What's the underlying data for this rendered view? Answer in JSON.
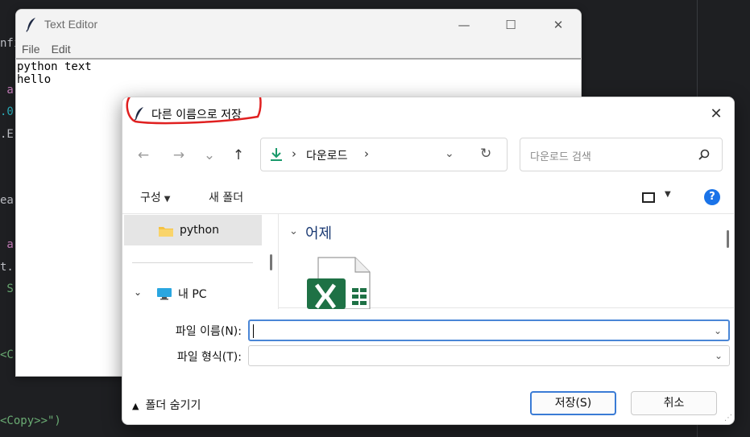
{
  "background_code": {
    "lines": [
      {
        "text": "nfi",
        "color": "#bcbec4"
      },
      {
        "text": " a",
        "color": "#c77dbb"
      },
      {
        "text": ".0",
        "color": "#2aacb8"
      },
      {
        "text": ".E",
        "color": "#bcbec4"
      },
      {
        "text": "ea",
        "color": "#bcbec4"
      },
      {
        "text": " a",
        "color": "#c77dbb"
      },
      {
        "text": "t.",
        "color": "#bcbec4"
      },
      {
        "text": " S",
        "color": "#6aab73"
      },
      {
        "text": "<C",
        "color": "#6aab73"
      },
      {
        "text": "<Copy>>\")",
        "color": "#6aab73"
      }
    ]
  },
  "text_editor": {
    "title": "Text Editor",
    "menu": [
      "File",
      "Edit"
    ],
    "content_lines": [
      "python text",
      "hello"
    ],
    "controls": {
      "minimize": "—",
      "maximize": "☐",
      "close": "✕"
    }
  },
  "save_dialog": {
    "title": "다른 이름으로 저장",
    "close": "✕",
    "annotation_color": "#e02020",
    "nav": {
      "back": "←",
      "forward": "→",
      "recent": "⌄",
      "up": "↑"
    },
    "address": {
      "location": "다운로드",
      "sep": "›"
    },
    "search_placeholder": "다운로드 검색",
    "toolbar": {
      "organize": "구성",
      "new_folder": "새 폴더",
      "help": "?"
    },
    "nav_pane": {
      "selected": "python",
      "this_pc": "내 PC"
    },
    "content": {
      "group": "어제"
    },
    "filename_label": "파일 이름(N):",
    "filename_value": "",
    "filetype_label": "파일 형식(T):",
    "filetype_value": "",
    "hide_folders": "폴더 숨기기",
    "save_button": "저장(S)",
    "cancel_button": "취소",
    "accent": "#3a7bd5"
  }
}
